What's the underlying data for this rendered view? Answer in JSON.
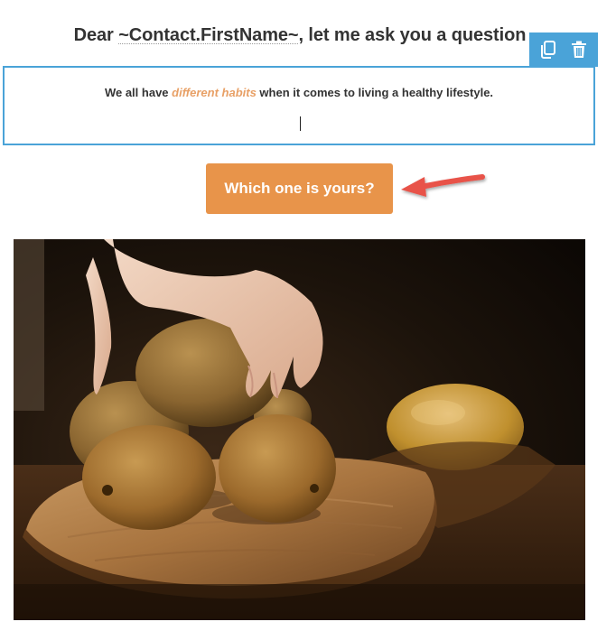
{
  "heading": {
    "prefix": "Dear ",
    "merge_tag": "~Contact.FirstName~",
    "suffix": ", let me ask you a question"
  },
  "toolbar": {
    "duplicate_icon": "copy-icon",
    "delete_icon": "trash-icon",
    "accent_color": "#4aa3d8"
  },
  "editor": {
    "text_before": "We all have ",
    "text_highlight": "different habits",
    "text_after": " when it comes to living a healthy lifestyle.",
    "highlight_color": "#e8a066"
  },
  "cta": {
    "label": "Which one is yours?",
    "color": "#e8944a"
  },
  "annotation": {
    "arrow_color": "#e8524a"
  },
  "image": {
    "subject": "kiwi-fruits-on-wooden-board"
  }
}
